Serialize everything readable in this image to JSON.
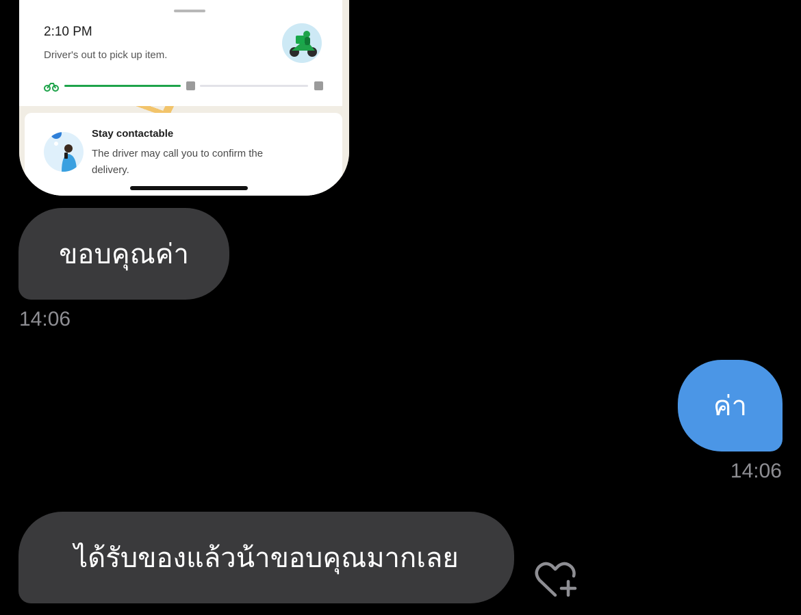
{
  "shared_image": {
    "status_time": "2:10 PM",
    "status_text": "Driver's out to pick up item.",
    "delivery_progress": 0.5,
    "contact_title": "Stay contactable",
    "contact_body": "The driver may call you to confirm the delivery.",
    "accent_color": "#1ea34a"
  },
  "messages": [
    {
      "direction": "incoming",
      "text": "ขอบคุณค่า",
      "time": "14:06"
    },
    {
      "direction": "outgoing",
      "text": "ค่า",
      "time": "14:06"
    },
    {
      "direction": "incoming",
      "text": "ได้รับของแล้วน้าขอบคุณมากเลย"
    }
  ],
  "icons": {
    "react": "heart-plus-icon"
  },
  "colors": {
    "background": "#000000",
    "incoming_bubble": "#3a3a3c",
    "outgoing_bubble": "#4b96e6",
    "timestamp": "#8e8e93"
  }
}
